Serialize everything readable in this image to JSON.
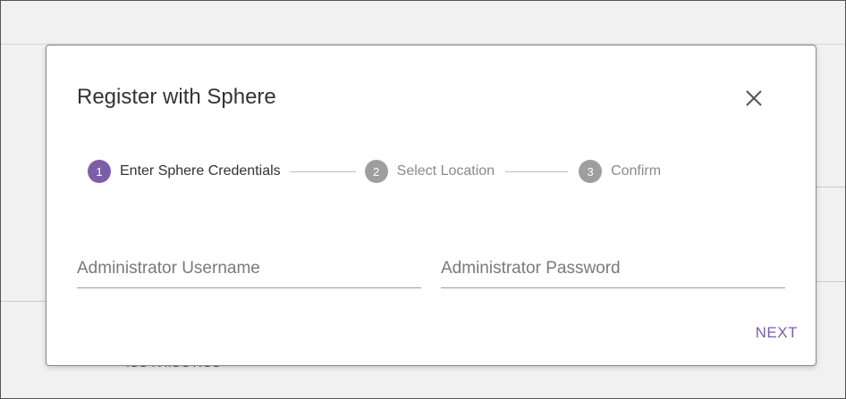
{
  "background": {
    "partial_text": "ISS IVIISCTICS"
  },
  "dialog": {
    "title": "Register with Sphere",
    "close_icon": "close-icon",
    "steps": [
      {
        "number": "1",
        "label": "Enter Sphere Credentials",
        "state": "active"
      },
      {
        "number": "2",
        "label": "Select Location",
        "state": "inactive"
      },
      {
        "number": "3",
        "label": "Confirm",
        "state": "inactive"
      }
    ],
    "fields": {
      "username": {
        "placeholder": "Administrator Username",
        "value": ""
      },
      "password": {
        "placeholder": "Administrator Password",
        "value": ""
      }
    },
    "next_label": "NEXT"
  },
  "colors": {
    "accent": "#7b5ea9",
    "inactive_step": "#9e9e9e",
    "backdrop": "#f1f1f1"
  }
}
